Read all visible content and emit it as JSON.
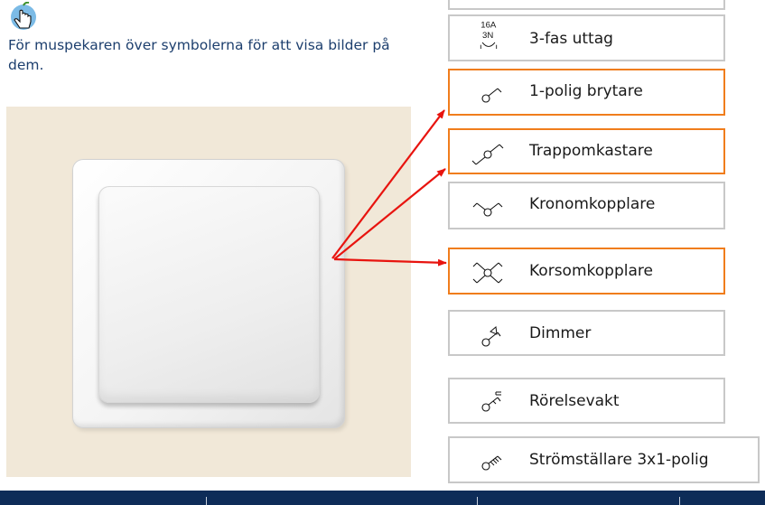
{
  "instruction": "För muspekaren över symbolerna för att visa bilder på dem.",
  "items": [
    {
      "label": "",
      "icon": "partial-item-icon"
    },
    {
      "label": "3-fas uttag",
      "icon": "three-phase-outlet-symbol-icon",
      "icon_text_1": "16A",
      "icon_text_2": "3N"
    },
    {
      "label": "1-polig brytare",
      "icon": "single-pole-switch-symbol-icon"
    },
    {
      "label": "Trappomkastare",
      "icon": "two-way-switch-symbol-icon"
    },
    {
      "label": "Kronomkopplare",
      "icon": "chandelier-switch-symbol-icon"
    },
    {
      "label": "Korsomkopplare",
      "icon": "intermediate-switch-symbol-icon"
    },
    {
      "label": "Dimmer",
      "icon": "dimmer-symbol-icon"
    },
    {
      "label": "Rörelsevakt",
      "icon": "motion-detector-symbol-icon"
    },
    {
      "label": "Strömställare 3x1-polig",
      "icon": "three-pole-switch-symbol-icon"
    }
  ],
  "colors": {
    "active_border": "#f07d1c",
    "inactive_border": "#c8c8c8",
    "arrow": "#e8140f",
    "footer": "#0e2c58",
    "text": "#1d3f6e",
    "photo_bg": "#f1e8d8"
  },
  "icons": {
    "hint": "pointer-hand-apple-icon",
    "arrow": "red-arrow-icon"
  }
}
